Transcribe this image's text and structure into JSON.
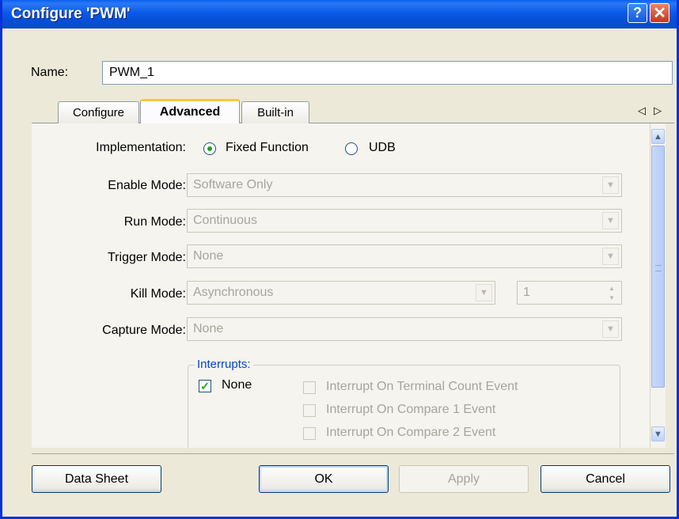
{
  "window": {
    "title": "Configure 'PWM'",
    "help_glyph": "?",
    "close_glyph": "✕"
  },
  "name_field": {
    "label": "Name:",
    "value": "PWM_1"
  },
  "tabs": [
    {
      "label": "Configure",
      "active": false
    },
    {
      "label": "Advanced",
      "active": true
    },
    {
      "label": "Built-in",
      "active": false
    }
  ],
  "tab_nav": {
    "left": "◁",
    "right": "▷"
  },
  "advanced": {
    "implementation": {
      "label": "Implementation:",
      "options": [
        {
          "label": "Fixed Function",
          "selected": true
        },
        {
          "label": "UDB",
          "selected": false
        }
      ]
    },
    "enable_mode": {
      "label": "Enable Mode:",
      "value": "Software Only"
    },
    "run_mode": {
      "label": "Run Mode:",
      "value": "Continuous"
    },
    "trigger_mode": {
      "label": "Trigger Mode:",
      "value": "None"
    },
    "kill_mode": {
      "label": "Kill Mode:",
      "value": "Asynchronous",
      "spin_value": "1"
    },
    "capture_mode": {
      "label": "Capture Mode:",
      "value": "None"
    },
    "interrupts": {
      "title": "Interrupts:",
      "none": {
        "label": "None",
        "checked": true
      },
      "items": [
        {
          "label": "Interrupt On Terminal Count Event",
          "checked": false
        },
        {
          "label": "Interrupt On Compare 1 Event",
          "checked": false
        },
        {
          "label": "Interrupt On Compare 2 Event",
          "checked": false
        }
      ]
    }
  },
  "buttons": {
    "datasheet": "Data Sheet",
    "ok": "OK",
    "apply": "Apply",
    "cancel": "Cancel"
  },
  "colors": {
    "titlebar": "#0a5ae8",
    "dialog_bg": "#ece9d8",
    "disabled_text": "#a6a59b",
    "accent_green": "#21a121"
  }
}
